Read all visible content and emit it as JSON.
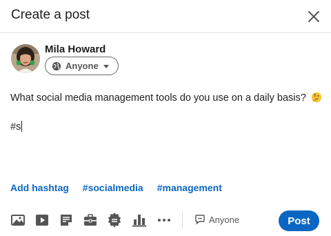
{
  "modal": {
    "title": "Create a post"
  },
  "author": {
    "name": "Mila Howard",
    "audience_label": "Anyone"
  },
  "post": {
    "text": "What social media management tools do you use on a daily basis?",
    "hashtag_input": "#s"
  },
  "hashtags": {
    "add_label": "Add hashtag",
    "suggestions": [
      "#socialmedia",
      "#management"
    ]
  },
  "toolbar": {
    "tools": [
      "photo-icon",
      "video-icon",
      "document-icon",
      "job-icon",
      "celebrate-icon",
      "poll-icon",
      "more-icon"
    ],
    "comment_control_label": "Anyone",
    "post_button_label": "Post"
  },
  "colors": {
    "accent": "#0a66c2",
    "text": "#1d1d1d",
    "muted": "#555555"
  }
}
